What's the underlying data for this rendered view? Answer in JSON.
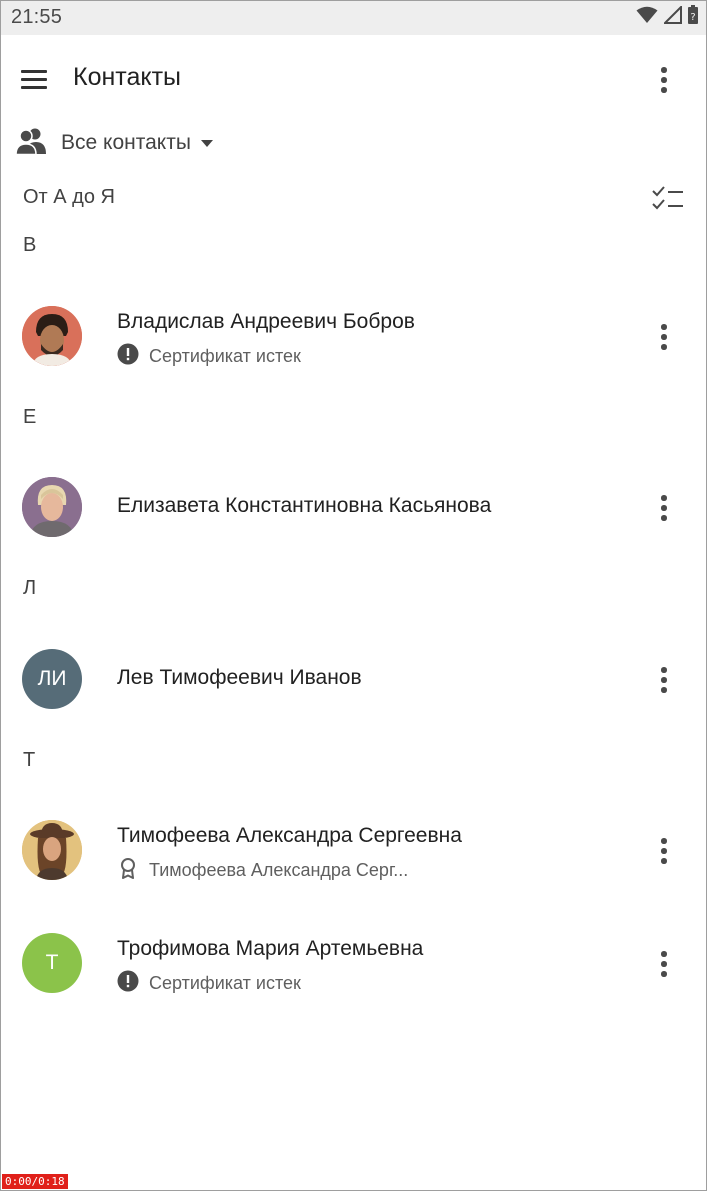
{
  "status_bar": {
    "time": "21:55",
    "icons": [
      "wifi-icon",
      "cell-signal-icon",
      "battery-icon"
    ]
  },
  "app_bar": {
    "title": "Контакты",
    "menu_icon": "hamburger-menu-icon",
    "overflow_icon": "more-vert-icon"
  },
  "filter": {
    "icon": "people-icon",
    "label": "Все контакты",
    "dropdown_icon": "arrow-drop-down-icon"
  },
  "sort": {
    "label": "От А до Я",
    "select_icon": "checklist-icon"
  },
  "sections": [
    {
      "letter": "В",
      "contacts": [
        {
          "name": "Владислав Андреевич Бобров",
          "avatar_type": "photo",
          "avatar_color": "#d9705a",
          "subtitle_icon": "alert-circle-icon",
          "subtitle": "Сертификат истек"
        }
      ]
    },
    {
      "letter": "Е",
      "contacts": [
        {
          "name": "Елизавета Константиновна Касьянова",
          "avatar_type": "photo",
          "avatar_color": "#8a6f8f",
          "subtitle_icon": "",
          "subtitle": ""
        }
      ]
    },
    {
      "letter": "Л",
      "contacts": [
        {
          "name": "Лев Тимофеевич Иванов",
          "avatar_type": "initials",
          "initials": "ЛИ",
          "avatar_color": "#566c78",
          "subtitle_icon": "",
          "subtitle": ""
        }
      ]
    },
    {
      "letter": "Т",
      "contacts": [
        {
          "name": "Тимофеева Александра Сергеевна",
          "avatar_type": "photo",
          "avatar_color": "#d9b46a",
          "subtitle_icon": "certificate-icon",
          "subtitle": "Тимофеева Александра Серг..."
        },
        {
          "name": "Трофимова Мария Артемьевна",
          "avatar_type": "initials",
          "initials": "Т",
          "avatar_color": "#8bc34a",
          "subtitle_icon": "alert-circle-icon",
          "subtitle": "Сертификат истек"
        }
      ]
    }
  ],
  "recording_badge": "0:00/0:18"
}
